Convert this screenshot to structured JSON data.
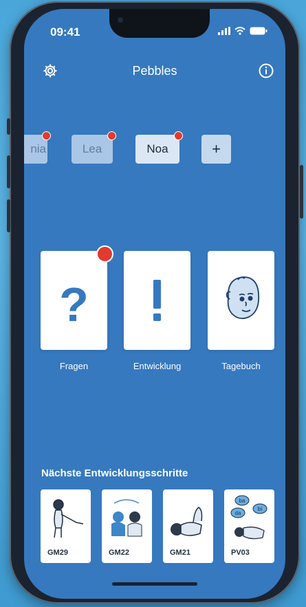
{
  "status_bar": {
    "time": "09:41"
  },
  "header": {
    "title": "Pebbles"
  },
  "profiles": [
    {
      "label": "nia"
    },
    {
      "label": "Lea"
    },
    {
      "label": "Noa"
    }
  ],
  "add_profile_label": "+",
  "cards": [
    {
      "label": "Fragen"
    },
    {
      "label": "Entwicklung"
    },
    {
      "label": "Tagebuch"
    }
  ],
  "next_steps": {
    "title": "Nächste Entwicklungsschritte",
    "items": [
      {
        "code": "GM29"
      },
      {
        "code": "GM22"
      },
      {
        "code": "GM21"
      },
      {
        "code": "PV03",
        "bubbles": [
          "ba",
          "bi",
          "da"
        ]
      }
    ]
  },
  "colors": {
    "background": "#3679bf",
    "accent_red": "#e23a2e",
    "card": "#ffffff"
  }
}
